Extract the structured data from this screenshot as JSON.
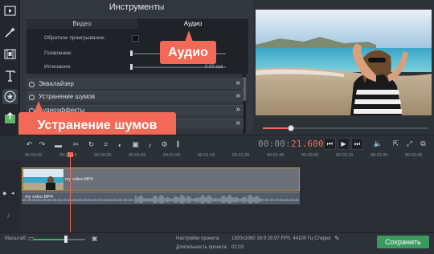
{
  "tools_panel": {
    "title": "Инструменты",
    "tabs": [
      "Видео",
      "Аудио"
    ],
    "active_tab": "Аудио",
    "props": {
      "reverse_label": "Обратное проигрывание:",
      "fade_in_label": "Появление:",
      "fade_out_label": "Исчезание:",
      "fade_in_value": 0,
      "fade_out_value": 0,
      "fade_out_value_text": "0.00 сек"
    },
    "sections": [
      {
        "label": "Эквалайзер"
      },
      {
        "label": "Устранение шумов"
      },
      {
        "label": "Аудиоэффекты"
      },
      {
        "label": ""
      }
    ]
  },
  "callouts": {
    "audio": "Аудио",
    "noise": "Устранение шумов"
  },
  "left_toolbar": {
    "icons": [
      "film-import-icon",
      "magic-wand-icon",
      "filmstrip-icon",
      "text-icon",
      "star-icon",
      "export-icon",
      "list-icon"
    ]
  },
  "preview": {
    "progress": 0.17
  },
  "timecode": {
    "prefix": "00:00:",
    "value": "21.600"
  },
  "ruler": {
    "labels": [
      "00:00:00",
      "00:00:15",
      "00:00:30",
      "00:00:45",
      "00:01:00",
      "00:01:15",
      "00:01:30",
      "00:01:45",
      "00:02:00",
      "00:02:15",
      "00:02:30",
      "00:02:45"
    ]
  },
  "timeline": {
    "video_clip_name": "my video.MP4",
    "audio_clip_name": "my video.MP4"
  },
  "bottom": {
    "zoom_label": "Масштаб:",
    "zoom_value": 0.62,
    "settings_label": "Настройки проекта:",
    "settings_value": "1920x1080 16:9 29.97 FPS, 44100 Гц Стерео",
    "duration_label": "Длительность проекта:",
    "duration_value": "02:03",
    "save_label": "Сохранить"
  },
  "colors": {
    "accent": "#f26a57",
    "save": "#3b9a5e",
    "clip_border": "#c79a2b"
  }
}
